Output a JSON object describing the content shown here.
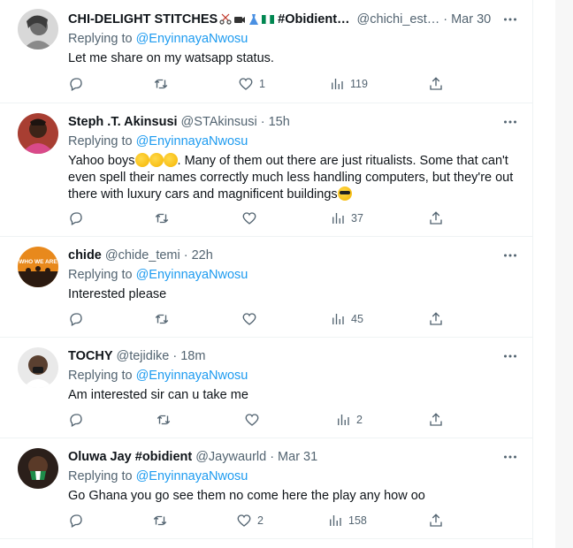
{
  "tweets": [
    {
      "name": "CHI-DELIGHT STITCHES",
      "name_suffix": "#Obidient…",
      "handle": "@chichi_est…",
      "time": "Mar 30",
      "replying_prefix": "Replying to ",
      "replying_to": "@EnyinnayaNwosu",
      "text": "Let me share on my watsapp status.",
      "likes": "1",
      "views": "119",
      "replies": "",
      "retweets": "",
      "avatar_color": "#9a9a9a"
    },
    {
      "name": "Steph .T. Akinsusi",
      "handle": "@STAkinsusi",
      "time": "15h",
      "replying_prefix": "Replying to ",
      "replying_to": "@EnyinnayaNwosu",
      "text_a": "Yahoo boys",
      "text_b": ". Many of them out there are just ritualists. Some that can't even spell their names correctly much less handling computers, but they're out there with luxury cars and magnificent buildings",
      "likes": "",
      "views": "37",
      "avatar_color": "#c0392b"
    },
    {
      "name": "chide",
      "handle": "@chide_temi",
      "time": "22h",
      "replying_prefix": "Replying to ",
      "replying_to": "@EnyinnayaNwosu",
      "text": "Interested please",
      "likes": "",
      "views": "45",
      "avatar_text": "WHO WE ARE",
      "avatar_color": "#e8891c"
    },
    {
      "name": "TOCHY",
      "handle": "@tejidike",
      "time": "18m",
      "replying_prefix": "Replying to ",
      "replying_to": "@EnyinnayaNwosu",
      "text": "Am interested sir can u take me",
      "likes": "",
      "views": "2",
      "avatar_color": "#6d5a4a"
    },
    {
      "name": "Oluwa Jay #obidient",
      "handle": "@Jaywaurld",
      "time": "Mar 31",
      "replying_prefix": "Replying to ",
      "replying_to": "@EnyinnayaNwosu",
      "text": "Go Ghana you go see them no come here the play any how oo",
      "likes": "2",
      "views": "158",
      "avatar_color": "#3a2a22"
    }
  ],
  "colors": {
    "text": "#0f1419",
    "muted": "#536471",
    "link": "#1d9bf0",
    "divider": "#eff3f4"
  },
  "icons": [
    "reply-icon",
    "retweet-icon",
    "like-icon",
    "views-icon",
    "share-icon",
    "more-icon"
  ]
}
